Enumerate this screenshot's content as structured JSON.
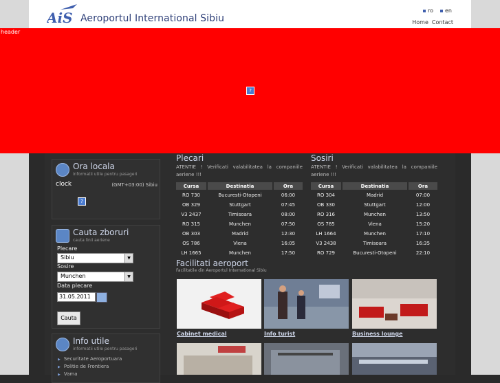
{
  "site": {
    "title": "Aeroportul International Sibiu",
    "logo_text": "AiS"
  },
  "lang": [
    "ro",
    "en"
  ],
  "toplinks": [
    "Home",
    "Contact"
  ],
  "header_label": "header",
  "header_image_alt": "?",
  "ora": {
    "title": "Ora locala",
    "sub": "informatii utile pentru pasageri",
    "clock": "clock",
    "gmt": "(GMT+03:00) Sibiu",
    "image_alt": "?"
  },
  "cauta": {
    "title": "Cauta zboruri",
    "sub": "cauta linii aeriene",
    "plecare_label": "Plecare",
    "plecare_value": "Sibiu",
    "sosire_label": "Sosire",
    "sosire_value": "Munchen",
    "date_label": "Data plecare",
    "date_value": "31.05.2011",
    "button": "Cauta"
  },
  "info": {
    "title": "Info utile",
    "sub": "informatii utile pentru pasageri",
    "links": [
      "Securitate Aeroportuara",
      "Politie de Frontiera",
      "Vama"
    ]
  },
  "plecari": {
    "title": "Plecari",
    "warning": "ATENTIE ! Verificati valabilitatea la companiile aeriene !!!",
    "headers": [
      "Cursa",
      "Destinatia",
      "Ora"
    ],
    "rows": [
      [
        "RO 730",
        "Bucuresti-Otopeni",
        "06:00"
      ],
      [
        "OB 329",
        "Stuttgart",
        "07:45"
      ],
      [
        "V3 2437",
        "Timisoara",
        "08:00"
      ],
      [
        "RO 315",
        "Munchen",
        "07:50"
      ],
      [
        "OB 303",
        "Madrid",
        "12:30"
      ],
      [
        "OS 786",
        "Viena",
        "16:05"
      ],
      [
        "LH 1665",
        "Munchen",
        "17:50"
      ]
    ]
  },
  "sosiri": {
    "title": "Sosiri",
    "warning": "ATENTIE ! Verificati valabilitatea la companiile aeriene !!!",
    "headers": [
      "Cursa",
      "Destinatia",
      "Ora"
    ],
    "rows": [
      [
        "RO 304",
        "Madrid",
        "07:00"
      ],
      [
        "OB 330",
        "Stuttgart",
        "12:00"
      ],
      [
        "RO 316",
        "Munchen",
        "13:50"
      ],
      [
        "OS 785",
        "Viena",
        "15:20"
      ],
      [
        "LH 1664",
        "Munchen",
        "17:10"
      ],
      [
        "V3 2438",
        "Timisoara",
        "16:35"
      ],
      [
        "RO 729",
        "Bucuresti-Otopeni",
        "22:10"
      ]
    ]
  },
  "facilitati": {
    "title": "Facilitati aeroport",
    "sub": "Facilitatile din Aeroportul International Sibiu",
    "tiles": [
      "Cabinet medical",
      "Info turist",
      "Business lounge"
    ]
  },
  "colors": {
    "header": "#ff0000",
    "accent": "#5b86c5"
  }
}
